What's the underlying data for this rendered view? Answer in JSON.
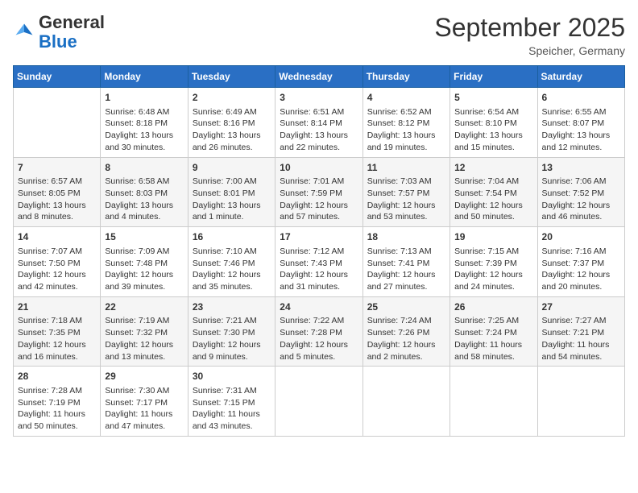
{
  "logo": {
    "general": "General",
    "blue": "Blue"
  },
  "header": {
    "month": "September 2025",
    "location": "Speicher, Germany"
  },
  "days_of_week": [
    "Sunday",
    "Monday",
    "Tuesday",
    "Wednesday",
    "Thursday",
    "Friday",
    "Saturday"
  ],
  "weeks": [
    [
      {
        "day": "",
        "info": ""
      },
      {
        "day": "1",
        "info": "Sunrise: 6:48 AM\nSunset: 8:18 PM\nDaylight: 13 hours and 30 minutes."
      },
      {
        "day": "2",
        "info": "Sunrise: 6:49 AM\nSunset: 8:16 PM\nDaylight: 13 hours and 26 minutes."
      },
      {
        "day": "3",
        "info": "Sunrise: 6:51 AM\nSunset: 8:14 PM\nDaylight: 13 hours and 22 minutes."
      },
      {
        "day": "4",
        "info": "Sunrise: 6:52 AM\nSunset: 8:12 PM\nDaylight: 13 hours and 19 minutes."
      },
      {
        "day": "5",
        "info": "Sunrise: 6:54 AM\nSunset: 8:10 PM\nDaylight: 13 hours and 15 minutes."
      },
      {
        "day": "6",
        "info": "Sunrise: 6:55 AM\nSunset: 8:07 PM\nDaylight: 13 hours and 12 minutes."
      }
    ],
    [
      {
        "day": "7",
        "info": "Sunrise: 6:57 AM\nSunset: 8:05 PM\nDaylight: 13 hours and 8 minutes."
      },
      {
        "day": "8",
        "info": "Sunrise: 6:58 AM\nSunset: 8:03 PM\nDaylight: 13 hours and 4 minutes."
      },
      {
        "day": "9",
        "info": "Sunrise: 7:00 AM\nSunset: 8:01 PM\nDaylight: 13 hours and 1 minute."
      },
      {
        "day": "10",
        "info": "Sunrise: 7:01 AM\nSunset: 7:59 PM\nDaylight: 12 hours and 57 minutes."
      },
      {
        "day": "11",
        "info": "Sunrise: 7:03 AM\nSunset: 7:57 PM\nDaylight: 12 hours and 53 minutes."
      },
      {
        "day": "12",
        "info": "Sunrise: 7:04 AM\nSunset: 7:54 PM\nDaylight: 12 hours and 50 minutes."
      },
      {
        "day": "13",
        "info": "Sunrise: 7:06 AM\nSunset: 7:52 PM\nDaylight: 12 hours and 46 minutes."
      }
    ],
    [
      {
        "day": "14",
        "info": "Sunrise: 7:07 AM\nSunset: 7:50 PM\nDaylight: 12 hours and 42 minutes."
      },
      {
        "day": "15",
        "info": "Sunrise: 7:09 AM\nSunset: 7:48 PM\nDaylight: 12 hours and 39 minutes."
      },
      {
        "day": "16",
        "info": "Sunrise: 7:10 AM\nSunset: 7:46 PM\nDaylight: 12 hours and 35 minutes."
      },
      {
        "day": "17",
        "info": "Sunrise: 7:12 AM\nSunset: 7:43 PM\nDaylight: 12 hours and 31 minutes."
      },
      {
        "day": "18",
        "info": "Sunrise: 7:13 AM\nSunset: 7:41 PM\nDaylight: 12 hours and 27 minutes."
      },
      {
        "day": "19",
        "info": "Sunrise: 7:15 AM\nSunset: 7:39 PM\nDaylight: 12 hours and 24 minutes."
      },
      {
        "day": "20",
        "info": "Sunrise: 7:16 AM\nSunset: 7:37 PM\nDaylight: 12 hours and 20 minutes."
      }
    ],
    [
      {
        "day": "21",
        "info": "Sunrise: 7:18 AM\nSunset: 7:35 PM\nDaylight: 12 hours and 16 minutes."
      },
      {
        "day": "22",
        "info": "Sunrise: 7:19 AM\nSunset: 7:32 PM\nDaylight: 12 hours and 13 minutes."
      },
      {
        "day": "23",
        "info": "Sunrise: 7:21 AM\nSunset: 7:30 PM\nDaylight: 12 hours and 9 minutes."
      },
      {
        "day": "24",
        "info": "Sunrise: 7:22 AM\nSunset: 7:28 PM\nDaylight: 12 hours and 5 minutes."
      },
      {
        "day": "25",
        "info": "Sunrise: 7:24 AM\nSunset: 7:26 PM\nDaylight: 12 hours and 2 minutes."
      },
      {
        "day": "26",
        "info": "Sunrise: 7:25 AM\nSunset: 7:24 PM\nDaylight: 11 hours and 58 minutes."
      },
      {
        "day": "27",
        "info": "Sunrise: 7:27 AM\nSunset: 7:21 PM\nDaylight: 11 hours and 54 minutes."
      }
    ],
    [
      {
        "day": "28",
        "info": "Sunrise: 7:28 AM\nSunset: 7:19 PM\nDaylight: 11 hours and 50 minutes."
      },
      {
        "day": "29",
        "info": "Sunrise: 7:30 AM\nSunset: 7:17 PM\nDaylight: 11 hours and 47 minutes."
      },
      {
        "day": "30",
        "info": "Sunrise: 7:31 AM\nSunset: 7:15 PM\nDaylight: 11 hours and 43 minutes."
      },
      {
        "day": "",
        "info": ""
      },
      {
        "day": "",
        "info": ""
      },
      {
        "day": "",
        "info": ""
      },
      {
        "day": "",
        "info": ""
      }
    ]
  ]
}
